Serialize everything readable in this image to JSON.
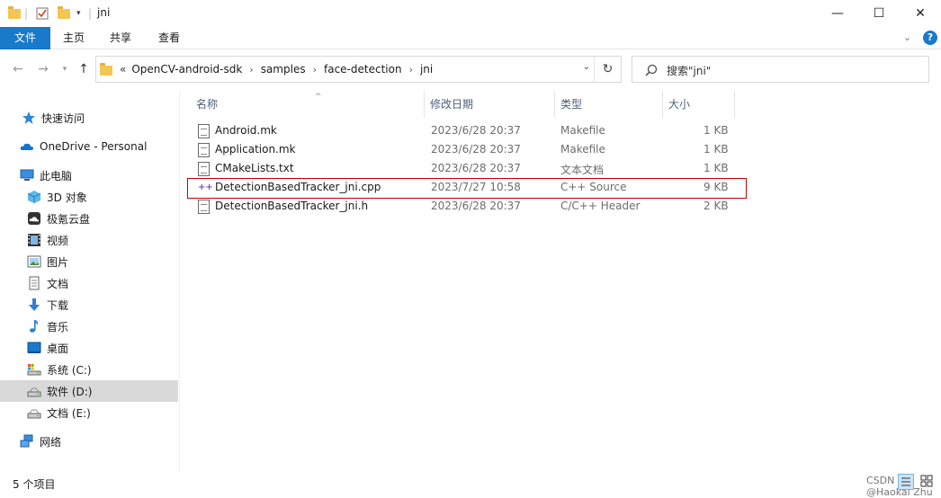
{
  "window": {
    "title": "jni",
    "minimize": "—",
    "maximize": "☐",
    "close": "✕"
  },
  "ribbon": {
    "tabs": [
      "文件",
      "主页",
      "共享",
      "查看"
    ],
    "help": "?"
  },
  "address": {
    "breadcrumbs": [
      "OpenCV-android-sdk",
      "samples",
      "face-detection",
      "jni"
    ],
    "overflow": "«",
    "search_placeholder": "搜索\"jni\""
  },
  "sidebar": {
    "items": [
      {
        "label": "快速访问",
        "icon": "star-icon"
      },
      {
        "label": "OneDrive - Personal",
        "icon": "cloud-icon"
      },
      {
        "label": "此电脑",
        "icon": "computer-icon"
      },
      {
        "label": "3D 对象",
        "icon": "cube-icon"
      },
      {
        "label": "极氪云盘",
        "icon": "cloud-drive-icon"
      },
      {
        "label": "视频",
        "icon": "video-icon"
      },
      {
        "label": "图片",
        "icon": "picture-icon"
      },
      {
        "label": "文档",
        "icon": "document-icon"
      },
      {
        "label": "下载",
        "icon": "download-icon"
      },
      {
        "label": "音乐",
        "icon": "music-icon"
      },
      {
        "label": "桌面",
        "icon": "desktop-icon"
      },
      {
        "label": "系统 (C:)",
        "icon": "drive-icon"
      },
      {
        "label": "软件 (D:)",
        "icon": "drive-icon"
      },
      {
        "label": "文档 (E:)",
        "icon": "drive-icon"
      },
      {
        "label": "网络",
        "icon": "network-icon"
      }
    ],
    "selected": "软件 (D:)"
  },
  "columns": {
    "name": "名称",
    "date": "修改日期",
    "type": "类型",
    "size": "大小"
  },
  "files": [
    {
      "name": "Android.mk",
      "date": "2023/6/28 20:37",
      "type": "Makefile",
      "size": "1 KB"
    },
    {
      "name": "Application.mk",
      "date": "2023/6/28 20:37",
      "type": "Makefile",
      "size": "1 KB"
    },
    {
      "name": "CMakeLists.txt",
      "date": "2023/6/28 20:37",
      "type": "文本文档",
      "size": "1 KB"
    },
    {
      "name": "DetectionBasedTracker_jni.cpp",
      "date": "2023/7/27 10:58",
      "type": "C++ Source",
      "size": "9 KB"
    },
    {
      "name": "DetectionBasedTracker_jni.h",
      "date": "2023/6/28 20:37",
      "type": "C/C++ Header",
      "size": "2 KB"
    }
  ],
  "status": {
    "count": "5 个项目",
    "watermark": "CSDN @Haokai Zhu"
  }
}
